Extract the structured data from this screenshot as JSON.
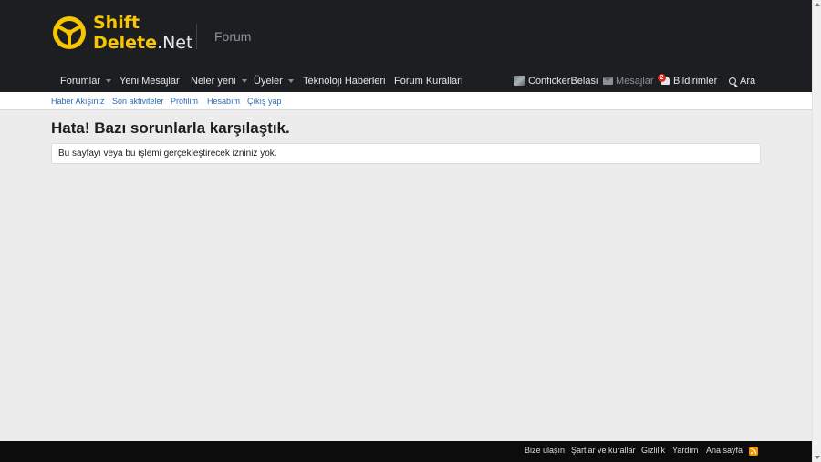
{
  "brand": {
    "logo_line1": "Shift",
    "logo_line2_main": "Delete",
    "logo_line2_suffix": ".Net",
    "section": "Forum",
    "accent": "#f7c600"
  },
  "nav": {
    "forumlar": "Forumlar",
    "yeni_mesajlar": "Yeni Mesajlar",
    "neler_yeni": "Neler yeni",
    "uyeler": "Üyeler",
    "teknoloji": "Teknoloji Haberleri",
    "kurallar": "Forum Kuralları",
    "user": "ConfickerBelasi",
    "mesajlar": "Mesajlar",
    "bildirimler": "Bildirimler",
    "bildirim_count": "2",
    "ara": "Ara"
  },
  "subnav": {
    "haber": "Haber Akışınız",
    "aktivite": "Son aktiviteler",
    "profil": "Profilim",
    "hesap": "Hesabım",
    "cikis": "Çıkış yap"
  },
  "main": {
    "title": "Hata! Bazı sorunlarla karşılaştık.",
    "message": "Bu sayfayı veya bu işlemi gerçekleştirecek izniniz yok."
  },
  "footer": {
    "bize_ulasin": "Bize ulaşın",
    "sartlar": "Şartlar ve kurallar",
    "gizlilik": "Gizlilik",
    "yardim": "Yardım",
    "ana_sayfa": "Ana sayfa"
  }
}
